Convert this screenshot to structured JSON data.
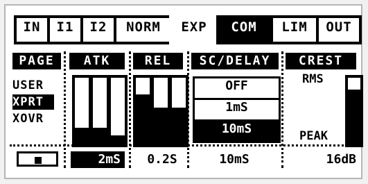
{
  "tabs": [
    {
      "label": "IN",
      "active": false
    },
    {
      "label": "I1",
      "active": false
    },
    {
      "label": "I2",
      "active": false
    },
    {
      "label": "NORM",
      "active": false
    },
    {
      "label": "EXP",
      "active": false
    },
    {
      "label": "COM",
      "active": true
    },
    {
      "label": "LIM",
      "active": false
    },
    {
      "label": "OUT",
      "active": false
    }
  ],
  "page": {
    "heading": "PAGE",
    "items": [
      {
        "label": "USER",
        "active": false
      },
      {
        "label": "XPRT",
        "active": true
      },
      {
        "label": "XOVR",
        "active": false
      }
    ]
  },
  "atk": {
    "heading": "ATK",
    "value": "2mS",
    "levels": [
      0.25,
      0.25,
      0.14
    ]
  },
  "rel": {
    "heading": "REL",
    "value": "0.2S",
    "levels": [
      0.75,
      0.55,
      0.55
    ]
  },
  "sc_delay": {
    "heading": "SC/DELAY",
    "options": [
      {
        "label": "OFF",
        "active": false
      },
      {
        "label": "1mS",
        "active": false
      },
      {
        "label": "10mS",
        "active": true
      }
    ],
    "value": "10mS"
  },
  "crest": {
    "heading": "CREST",
    "top_label": "RMS",
    "bottom_label": "PEAK",
    "value": "16dB",
    "level": 0.82
  },
  "colors": {
    "ink": "#000000",
    "paper": "#ffffff",
    "frame": "#b5b5b5"
  }
}
